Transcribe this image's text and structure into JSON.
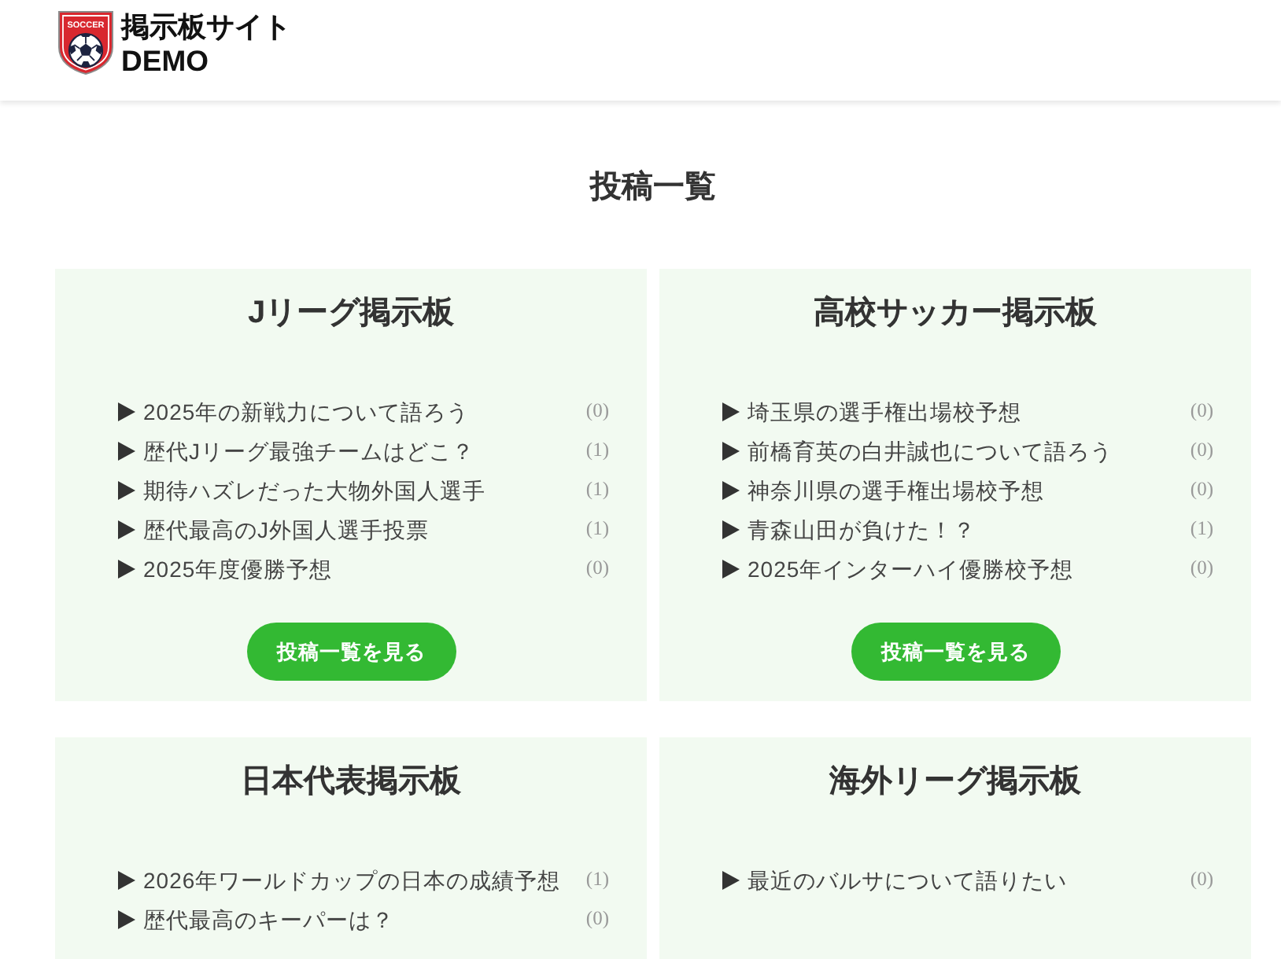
{
  "header": {
    "logo_text": "SOCCER",
    "title": "掲示板サイト",
    "subtitle": "DEMO"
  },
  "page_heading": "投稿一覧",
  "boards": [
    {
      "title": "Jリーグ掲示板",
      "threads": [
        {
          "title": "2025年の新戦力について語ろう",
          "count": "(0)"
        },
        {
          "title": "歴代Jリーグ最強チームはどこ？",
          "count": "(1)"
        },
        {
          "title": "期待ハズレだった大物外国人選手",
          "count": "(1)"
        },
        {
          "title": "歴代最高のJ外国人選手投票",
          "count": "(1)"
        },
        {
          "title": "2025年度優勝予想",
          "count": "(0)"
        }
      ],
      "button": "投稿一覧を見る"
    },
    {
      "title": "高校サッカー掲示板",
      "threads": [
        {
          "title": "埼玉県の選手権出場校予想",
          "count": "(0)"
        },
        {
          "title": "前橋育英の白井誠也について語ろう",
          "count": "(0)"
        },
        {
          "title": "神奈川県の選手権出場校予想",
          "count": "(0)"
        },
        {
          "title": "青森山田が負けた！？",
          "count": "(1)"
        },
        {
          "title": "2025年インターハイ優勝校予想",
          "count": "(0)"
        }
      ],
      "button": "投稿一覧を見る"
    },
    {
      "title": "日本代表掲示板",
      "threads": [
        {
          "title": "2026年ワールドカップの日本の成績予想",
          "count": "(1)"
        },
        {
          "title": "歴代最高のキーパーは？",
          "count": "(0)"
        }
      ]
    },
    {
      "title": "海外リーグ掲示板",
      "threads": [
        {
          "title": "最近のバルサについて語りたい",
          "count": "(0)"
        }
      ]
    }
  ]
}
